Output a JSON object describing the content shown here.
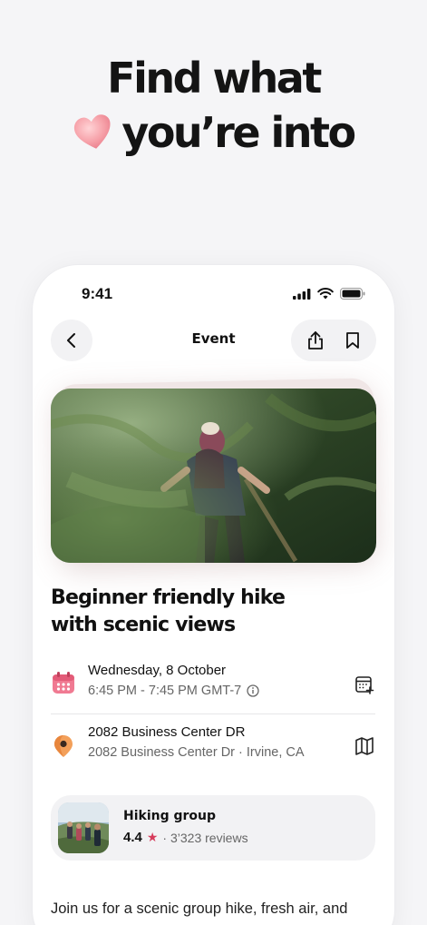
{
  "headline": {
    "line1": "Find what",
    "line2": "you’re into"
  },
  "status_bar": {
    "time": "9:41"
  },
  "nav": {
    "title": "Event"
  },
  "event": {
    "title": "Beginner friendly hike with scenic views"
  },
  "date_row": {
    "date": "Wednesday, 8 October",
    "time": "6:45 PM - 7:45 PM GMT-7"
  },
  "location_row": {
    "name": "2082 Business Center DR",
    "address": "2082 Business Center Dr · Irvine, CA"
  },
  "group": {
    "name": "Hiking group",
    "rating": "4.4",
    "reviews": "· 3’323 reviews"
  },
  "description": "Join us for a scenic group hike, fresh air, and",
  "colors": {
    "accent": "#d63b5b",
    "card_bg": "#f2f2f4",
    "page_bg": "#f5f5f7"
  },
  "icons": [
    "heart-icon",
    "signal-icon",
    "wifi-icon",
    "battery-icon",
    "chevron-left-icon",
    "share-icon",
    "bookmark-icon",
    "calendar-icon",
    "info-icon",
    "add-to-calendar-icon",
    "location-pin-icon",
    "map-icon",
    "star-icon"
  ]
}
